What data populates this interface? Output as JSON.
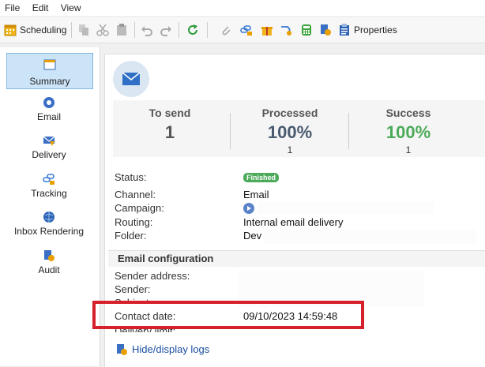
{
  "menu": {
    "file": "File",
    "edit": "Edit",
    "view": "View"
  },
  "toolbar": {
    "scheduling": "Scheduling",
    "properties": "Properties"
  },
  "sidebar": {
    "items": [
      {
        "label": "Summary",
        "icon": "summary-icon"
      },
      {
        "label": "Email",
        "icon": "email-icon"
      },
      {
        "label": "Delivery",
        "icon": "delivery-icon"
      },
      {
        "label": "Tracking",
        "icon": "tracking-icon"
      },
      {
        "label": "Inbox Rendering",
        "icon": "inbox-rendering-icon"
      },
      {
        "label": "Audit",
        "icon": "audit-icon"
      }
    ]
  },
  "stats": {
    "to_send": {
      "label": "To send",
      "value": "1"
    },
    "processed": {
      "label": "Processed",
      "value": "100%",
      "count": "1"
    },
    "success": {
      "label": "Success",
      "value": "100%",
      "count": "1"
    }
  },
  "details": {
    "status_label": "Status:",
    "status_value": "Finished",
    "channel_label": "Channel:",
    "channel_value": "Email",
    "campaign_label": "Campaign:",
    "routing_label": "Routing:",
    "routing_value": "Internal email delivery",
    "folder_label": "Folder:",
    "folder_value": "Dev"
  },
  "email_config": {
    "title": "Email configuration",
    "sender_address_label": "Sender address:",
    "sender_label": "Sender:",
    "subject_label": "Subject:",
    "contact_date_label": "Contact date:",
    "contact_date_value": "09/10/2023 14:59:48",
    "delivery_limit_label": "Delivery limit:"
  },
  "logs_link": "Hide/display logs",
  "colors": {
    "success_green": "#4caa5a",
    "highlight_red": "#d6202a",
    "link_blue": "#1a4fa0",
    "active_nav": "#cce4f7"
  }
}
